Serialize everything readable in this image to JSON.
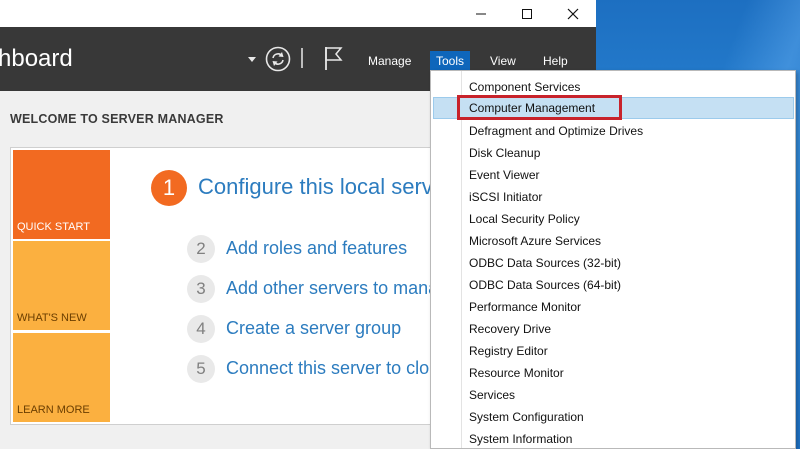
{
  "window": {
    "header_title": "hboard"
  },
  "header": {
    "menu": [
      "Manage",
      "Tools",
      "View",
      "Help"
    ],
    "active_menu": "Tools"
  },
  "welcome": {
    "title": "WELCOME TO SERVER MANAGER",
    "tiles": [
      "QUICK START",
      "WHAT'S NEW",
      "LEARN MORE"
    ],
    "steps": [
      {
        "num": "1",
        "text": "Configure this local serv"
      },
      {
        "num": "2",
        "text": "Add roles and features"
      },
      {
        "num": "3",
        "text": "Add other servers to mana"
      },
      {
        "num": "4",
        "text": "Create a server group"
      },
      {
        "num": "5",
        "text": "Connect this server to clou"
      }
    ]
  },
  "tools_menu": {
    "items": [
      "Component Services",
      "Computer Management",
      "Defragment and Optimize Drives",
      "Disk Cleanup",
      "Event Viewer",
      "iSCSI Initiator",
      "Local Security Policy",
      "Microsoft Azure Services",
      "ODBC Data Sources (32-bit)",
      "ODBC Data Sources (64-bit)",
      "Performance Monitor",
      "Recovery Drive",
      "Registry Editor",
      "Resource Monitor",
      "Services",
      "System Configuration",
      "System Information"
    ],
    "highlighted": "Computer Management"
  },
  "colors": {
    "header_bg": "#383838",
    "accent_blue": "#0e66bb",
    "quick_start_orange": "#f26a21",
    "tile_amber": "#fbb040",
    "highlight_red": "#c8232b"
  }
}
